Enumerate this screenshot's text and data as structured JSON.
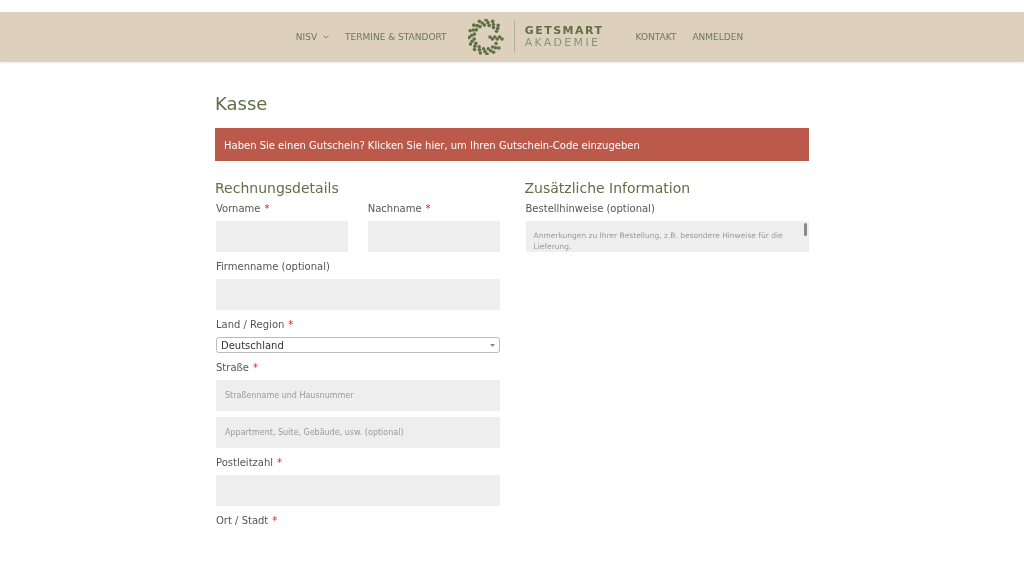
{
  "nav": {
    "left": [
      {
        "label": "NISV",
        "dropdown": true
      },
      {
        "label": "TERMINE & STANDORT"
      }
    ],
    "logo": {
      "line1": "GETSMART",
      "line2": "AKADEMIE"
    },
    "right": [
      {
        "label": "KONTAKT"
      },
      {
        "label": "ANMELDEN"
      }
    ]
  },
  "page_title": "Kasse",
  "coupon_notice": "Haben Sie einen Gutschein? Klicken Sie hier, um Ihren Gutschein-Code einzugeben",
  "billing": {
    "heading": "Rechnungsdetails",
    "rows": [
      {
        "fields": [
          {
            "label": "Vorname",
            "required_mark": "*",
            "kind": "text"
          },
          {
            "label": "Nachname",
            "required_mark": "*",
            "kind": "text"
          }
        ]
      },
      {
        "fields": [
          {
            "label": "Firmenname (optional)",
            "kind": "text"
          }
        ]
      },
      {
        "fields": [
          {
            "label": "Land / Region",
            "required_mark": "*",
            "kind": "select",
            "value": "Deutschland"
          }
        ]
      },
      {
        "fields": [
          {
            "label": "Straße",
            "required_mark": "*",
            "kind": "text",
            "placeholders": [
              "Straßenname und Hausnummer",
              "Appartment, Suite, Gebäude, usw. (optional)"
            ]
          }
        ]
      },
      {
        "fields": [
          {
            "label": "Postleitzahl",
            "required_mark": "*",
            "kind": "text"
          }
        ]
      },
      {
        "fields": [
          {
            "label": "Ort / Stadt",
            "required_mark": "*"
          }
        ]
      }
    ]
  },
  "additional": {
    "heading": "Zusätzliche Information",
    "fields": [
      {
        "label": "Bestellhinweise (optional)",
        "kind": "textarea",
        "placeholder": "Anmerkungen zu Ihrer Bestellung, z.B. besondere Hinweise für die Lieferung."
      }
    ]
  }
}
